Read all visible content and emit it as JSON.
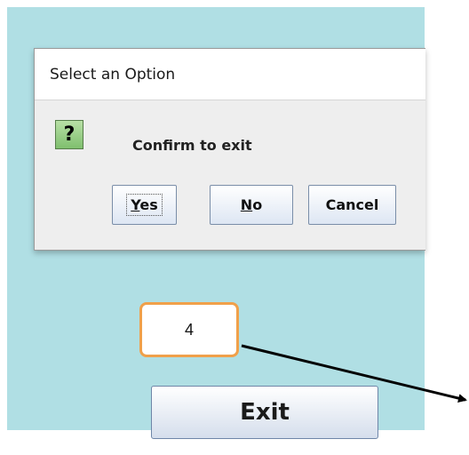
{
  "dialog": {
    "title": "Select an Option",
    "icon": "question-icon",
    "icon_glyph": "?",
    "message": "Confirm to exit",
    "buttons": {
      "yes_mnemonic": "Y",
      "yes_rest": "es",
      "no_mnemonic": "N",
      "no_rest": "o",
      "cancel": "Cancel"
    }
  },
  "callout": {
    "number": "4",
    "border_color": "#f0a04a"
  },
  "exit_button": {
    "label": "Exit"
  },
  "colors": {
    "background": "#b0dfe4",
    "dialog_body": "#eeeeee",
    "button_border": "#7a8ea8"
  }
}
